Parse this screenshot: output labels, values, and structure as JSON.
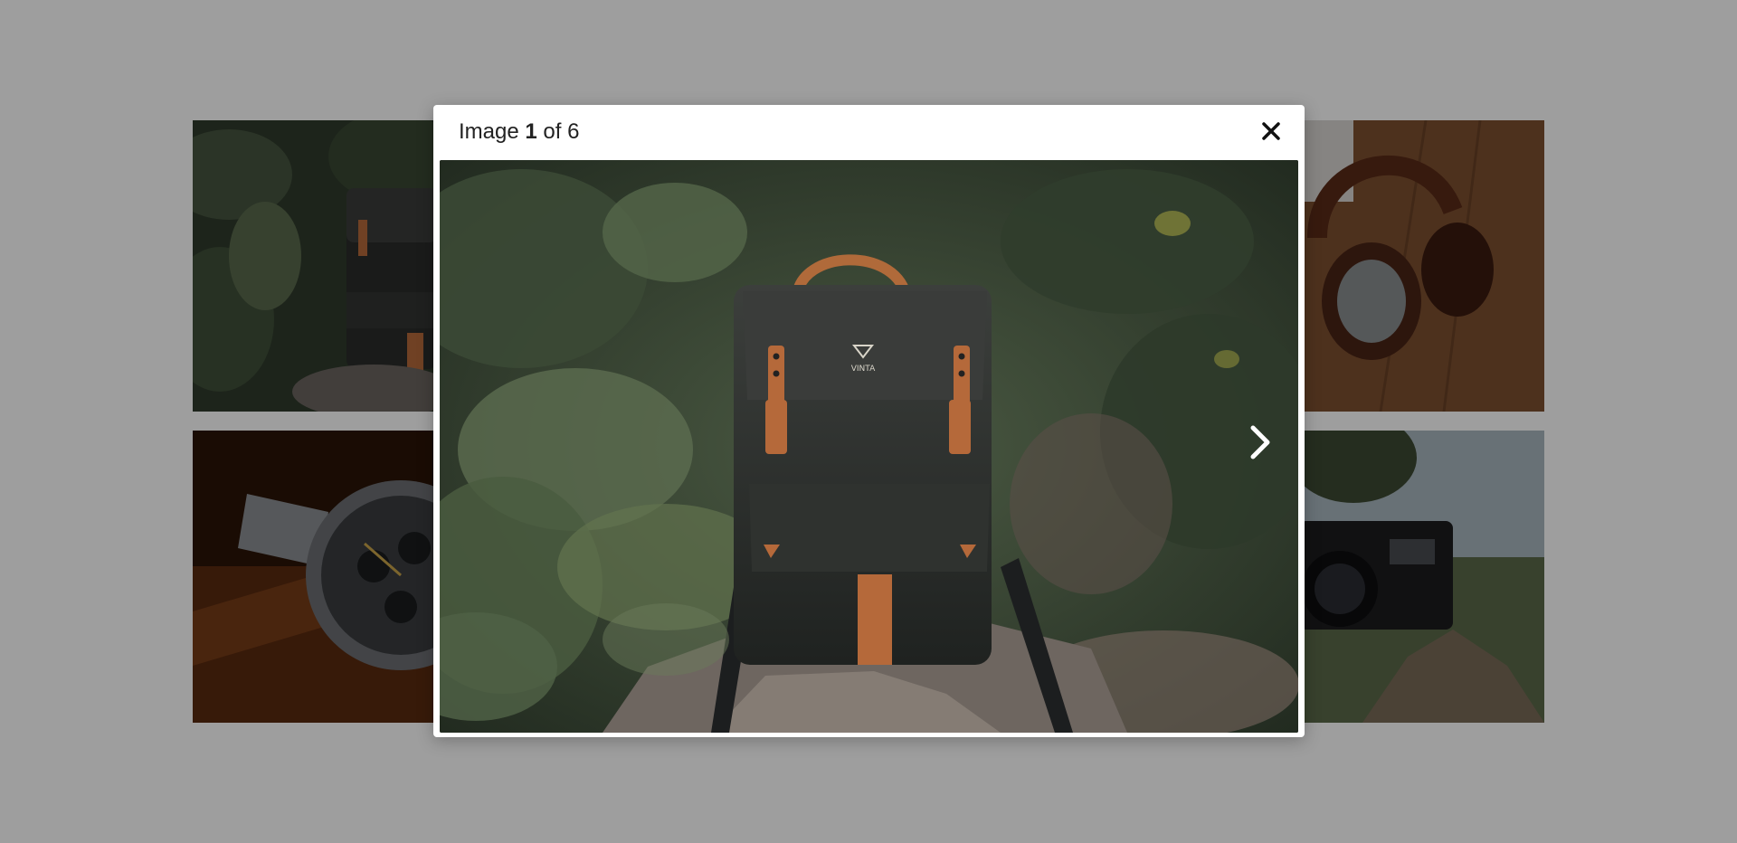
{
  "lightbox": {
    "title_prefix": "Image",
    "current_index": "1",
    "title_mid": "of",
    "total_count": "6",
    "close_icon": "close-icon",
    "next_icon": "chevron-right-icon"
  },
  "gallery": {
    "thumbnails": [
      {
        "subject": "backpack",
        "icon": "backpack-image"
      },
      {
        "subject": "wristwatch",
        "icon": "watch-image"
      },
      {
        "subject": "headphones",
        "icon": "headphones-image"
      },
      {
        "subject": "camera",
        "icon": "camera-image"
      }
    ]
  },
  "colors": {
    "overlay": "#000000",
    "modal_bg": "#ffffff",
    "title_text": "#222222"
  }
}
